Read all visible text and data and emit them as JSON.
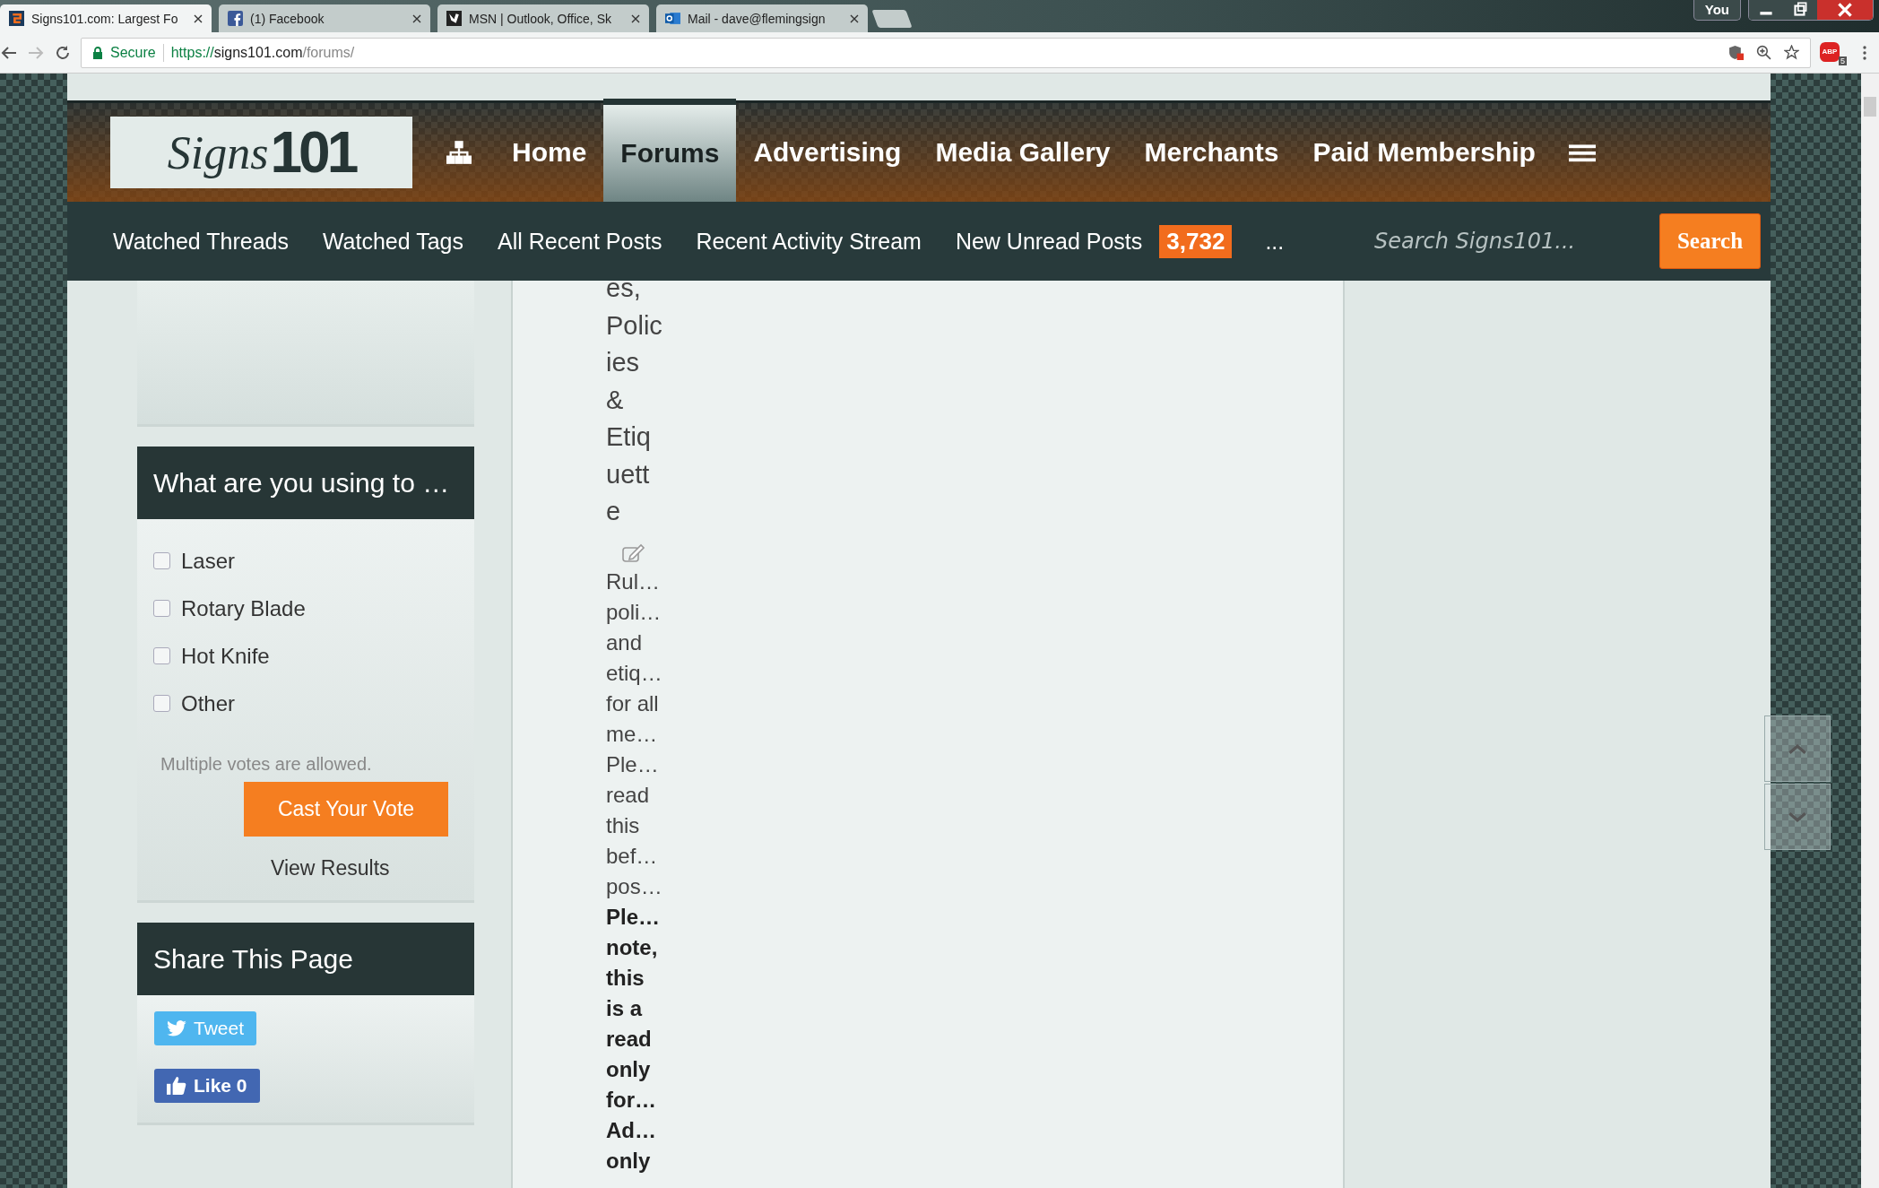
{
  "browser_tabs": [
    {
      "title": "Signs101.com: Largest Fo",
      "selected": true
    },
    {
      "title": "(1) Facebook",
      "selected": false
    },
    {
      "title": "MSN | Outlook, Office, Sk",
      "selected": false
    },
    {
      "title": "Mail - dave@flemingsign",
      "selected": false
    }
  ],
  "window_controls": {
    "profile": "You"
  },
  "address_bar": {
    "secure_label": "Secure",
    "url_scheme": "https://",
    "url_host": "signs101.com",
    "url_path": "/forums/"
  },
  "extensions": {
    "adblock_label": "ABP",
    "adblock_count": "5"
  },
  "logo": {
    "script": "Signs",
    "number": "101"
  },
  "main_nav": [
    {
      "label": "Home",
      "selected": false
    },
    {
      "label": "Forums",
      "selected": true
    },
    {
      "label": "Advertising",
      "selected": false
    },
    {
      "label": "Media Gallery",
      "selected": false
    },
    {
      "label": "Merchants",
      "selected": false
    },
    {
      "label": "Paid Membership",
      "selected": false
    }
  ],
  "sub_nav": {
    "items": [
      {
        "label": "Watched Threads"
      },
      {
        "label": "Watched Tags"
      },
      {
        "label": "All Recent Posts"
      },
      {
        "label": "Recent Activity Stream"
      },
      {
        "label": "New Unread Posts",
        "badge": "3,732"
      },
      {
        "label": "..."
      }
    ],
    "search": {
      "placeholder": "Search Signs101..."
    },
    "search_button": "Search"
  },
  "poll": {
    "title": "What are you using to …",
    "options": [
      {
        "label": "Laser",
        "checked": false
      },
      {
        "label": "Rotary Blade",
        "checked": false
      },
      {
        "label": "Hot Knife",
        "checked": false
      },
      {
        "label": "Other",
        "checked": false
      }
    ],
    "note": "Multiple votes are allowed.",
    "vote_button": "Cast Your Vote",
    "results_link": "View Results"
  },
  "share": {
    "title": "Share This Page",
    "tweet_button": "Tweet",
    "like_button": "Like 0"
  },
  "forum": {
    "title_lines": [
      "es,",
      "Polic",
      "ies",
      "&",
      "Etiq",
      "uett",
      "e"
    ],
    "description_lines": [
      {
        "text": "Rul…",
        "bold": false
      },
      {
        "text": "poli…",
        "bold": false
      },
      {
        "text": "and",
        "bold": false
      },
      {
        "text": "etiq…",
        "bold": false
      },
      {
        "text": "for all",
        "bold": false
      },
      {
        "text": "me…",
        "bold": false
      },
      {
        "text": "Ple…",
        "bold": false
      },
      {
        "text": "read",
        "bold": false
      },
      {
        "text": "this",
        "bold": false
      },
      {
        "text": "bef…",
        "bold": false
      },
      {
        "text": "pos…",
        "bold": false
      },
      {
        "text": "Ple…",
        "bold": true
      },
      {
        "text": "note,",
        "bold": true
      },
      {
        "text": "this",
        "bold": true
      },
      {
        "text": "is a",
        "bold": true
      },
      {
        "text": "read",
        "bold": true
      },
      {
        "text": "only",
        "bold": true
      },
      {
        "text": "for…",
        "bold": true
      },
      {
        "text": "Ad…",
        "bold": true
      },
      {
        "text": "only",
        "bold": true
      }
    ]
  }
}
